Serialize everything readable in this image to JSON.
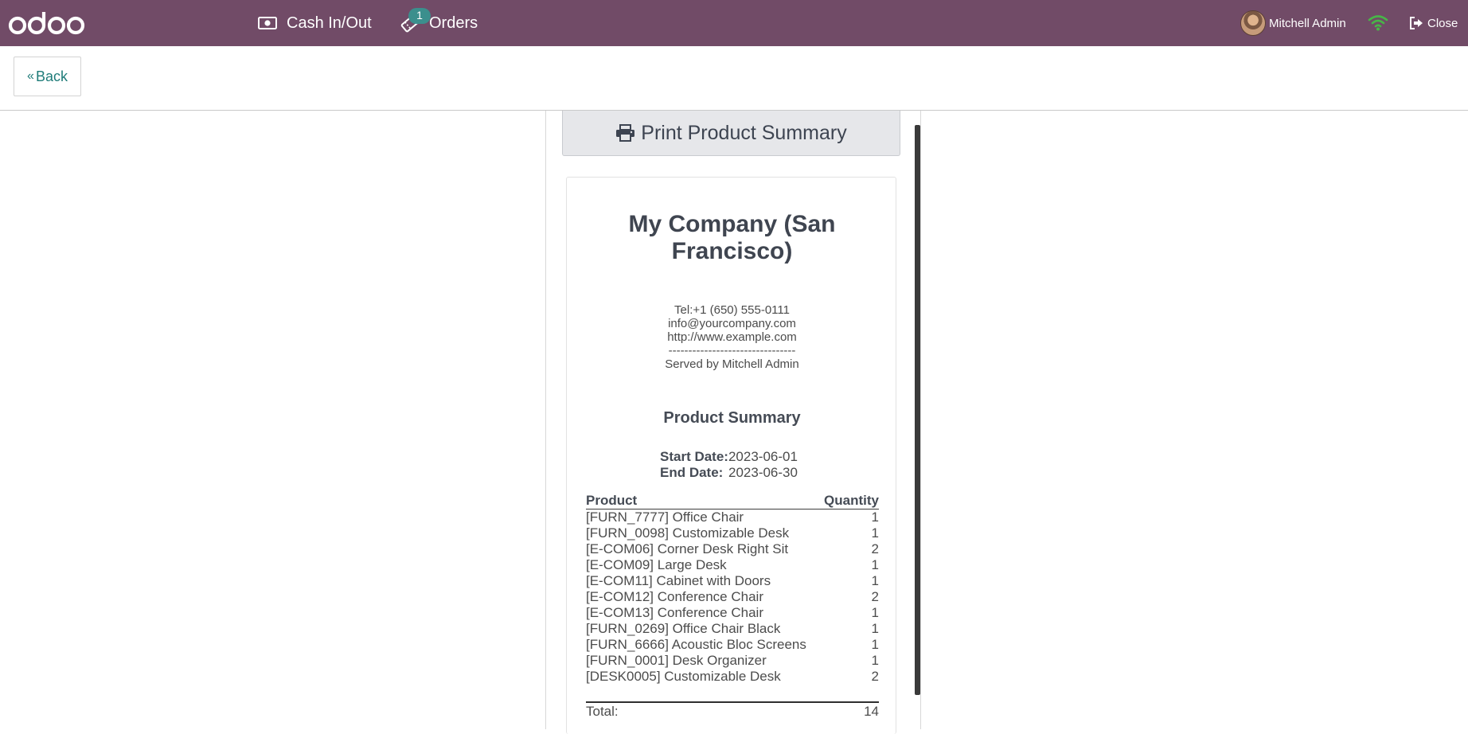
{
  "navbar": {
    "logo_text": "odoo",
    "cash_label": "Cash In/Out",
    "orders_label": "Orders",
    "orders_badge": "1",
    "user_name": "Mitchell Admin",
    "close_label": "Close",
    "icons": [
      "cash-icon",
      "orders-ticket-icon",
      "wifi-icon",
      "sign-out-icon"
    ],
    "colors": {
      "bar": "#714b67",
      "badge": "#3b8f8d",
      "wifi": "#48b548"
    }
  },
  "subheader": {
    "back_label": "Back"
  },
  "receipt": {
    "print_label": "Print Product Summary",
    "company_line1": "My Company (San",
    "company_line2": "Francisco)",
    "tel": "Tel:+1 (650) 555-0111",
    "email": "info@yourcompany.com",
    "website": "http://www.example.com",
    "separator": "--------------------------------",
    "served_by": "Served by Mitchell Admin",
    "summary_title": "Product Summary",
    "start_label": "Start Date:",
    "start_value": "2023-06-01",
    "end_label": "End Date:",
    "end_value": "2023-06-30",
    "col_product": "Product",
    "col_quantity": "Quantity",
    "rows": [
      {
        "product": "[FURN_7777] Office Chair",
        "qty": "1"
      },
      {
        "product": "[FURN_0098] Customizable Desk",
        "qty": "1"
      },
      {
        "product": "[E-COM06] Corner Desk Right Sit",
        "qty": "2"
      },
      {
        "product": "[E-COM09] Large Desk",
        "qty": "1"
      },
      {
        "product": "[E-COM11] Cabinet with Doors",
        "qty": "1"
      },
      {
        "product": "[E-COM12] Conference Chair",
        "qty": "2"
      },
      {
        "product": "[E-COM13] Conference Chair",
        "qty": "1"
      },
      {
        "product": "[FURN_0269] Office Chair Black",
        "qty": "1"
      },
      {
        "product": "[FURN_6666] Acoustic Bloc Screens",
        "qty": "1"
      },
      {
        "product": "[FURN_0001] Desk Organizer",
        "qty": "1"
      },
      {
        "product": "[DESK0005] Customizable Desk",
        "qty": "2"
      }
    ],
    "total_label": "Total:",
    "total_value": "14"
  }
}
